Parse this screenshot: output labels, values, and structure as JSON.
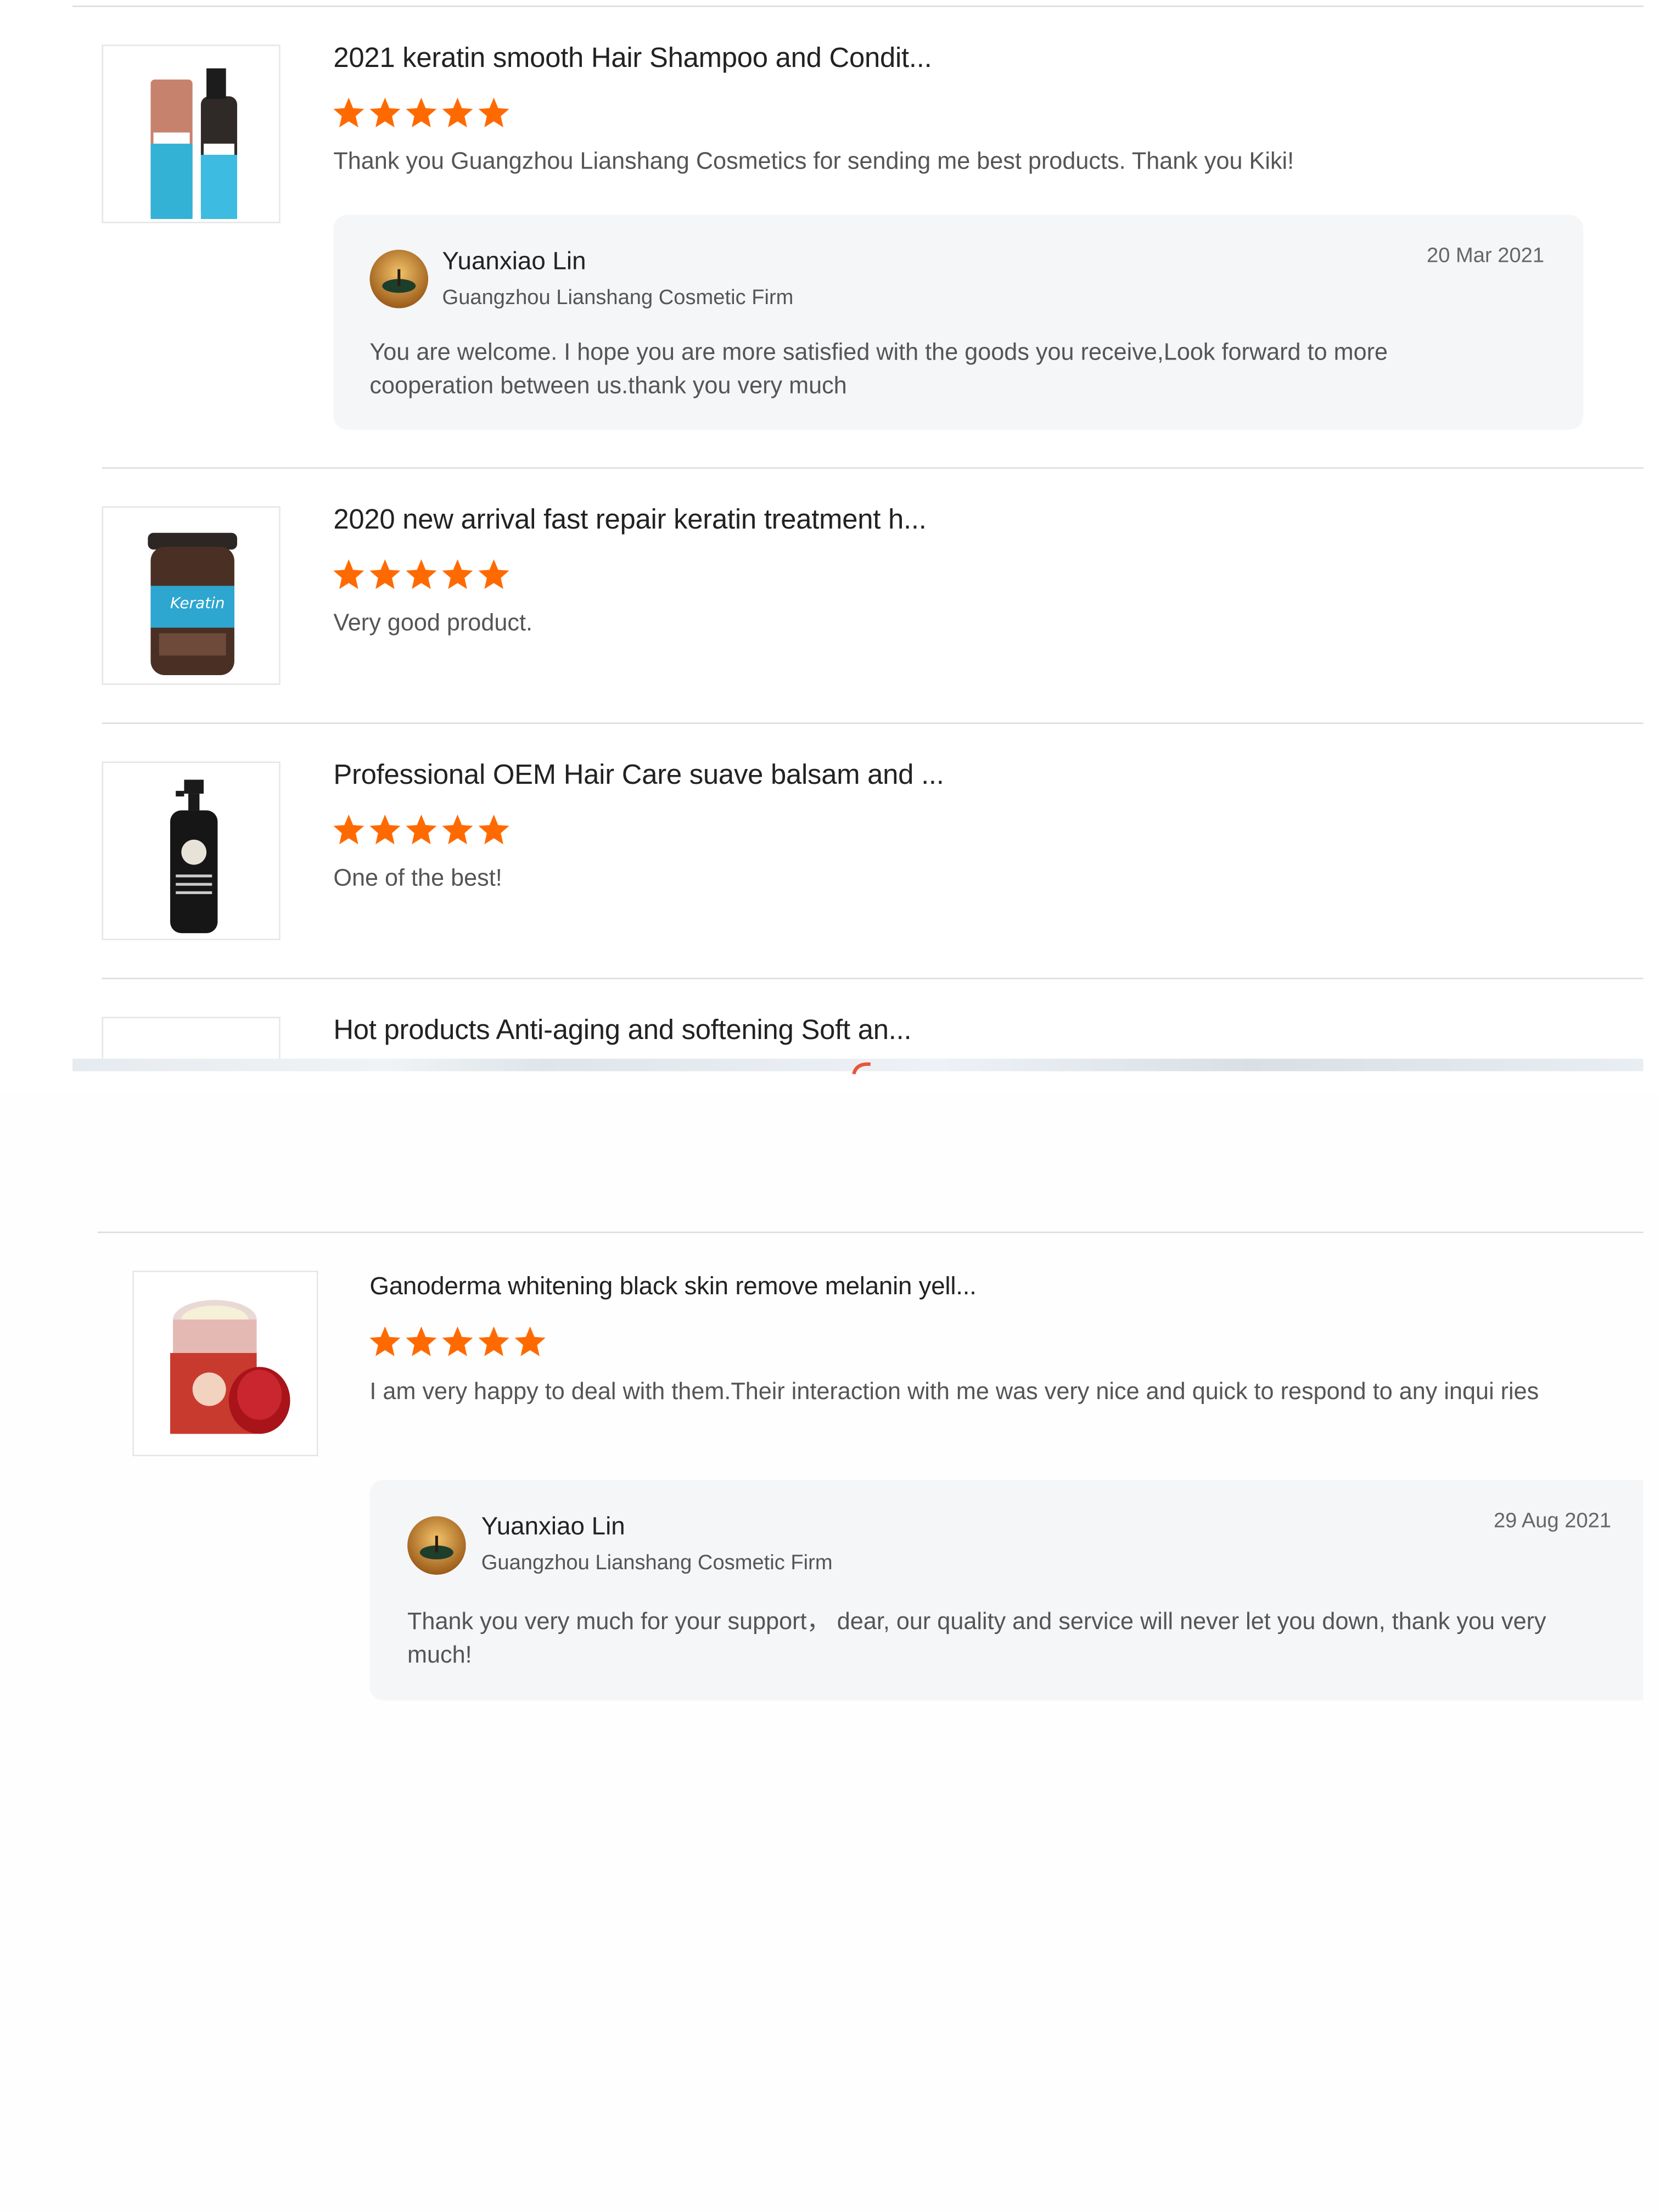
{
  "colors": {
    "star": "#ff6a00",
    "reply_bg": "#f5f6f8",
    "divider": "#dcdcdc"
  },
  "reviews_top": [
    {
      "product_title": "2021 keratin smooth Hair Shampoo and Condit...",
      "rating": 5,
      "comment": "Thank you Guangzhou Lianshang Cosmetics for sending me best products. Thank you Kiki!",
      "thumb_icon": "shampoo-conditioner-bottles",
      "reply": {
        "name": "Yuanxiao Lin",
        "firm": "Guangzhou Lianshang Cosmetic Firm",
        "date": "20 Mar 2021",
        "text": "You are welcome. I hope you are more satisfied with the goods you receive,Look forward to more cooperation between us.thank you very much"
      }
    },
    {
      "product_title": "2020 new arrival fast repair keratin treatment h...",
      "rating": 5,
      "comment": "Very good product.",
      "thumb_icon": "keratin-hair-mask-jar"
    },
    {
      "product_title": "Professional OEM Hair Care suave balsam and ...",
      "rating": 5,
      "comment": "One of the best!",
      "thumb_icon": "black-pump-bottle"
    },
    {
      "product_title": "Hot products Anti-aging and softening Soft an..."
    }
  ],
  "review_bottom": {
    "product_title": "Ganoderma whitening black skin remove melanin yell...",
    "rating": 5,
    "comment": "I am very happy to deal with them.Their interaction with me was very nice and quick to respond to any inqui ries",
    "thumb_icon": "red-cream-jar",
    "reply": {
      "name": "Yuanxiao Lin",
      "firm": "Guangzhou Lianshang Cosmetic Firm",
      "date": "29 Aug 2021",
      "text": "Thank you very much for your support，  dear, our quality and service will never let you down, thank you very much!"
    }
  }
}
